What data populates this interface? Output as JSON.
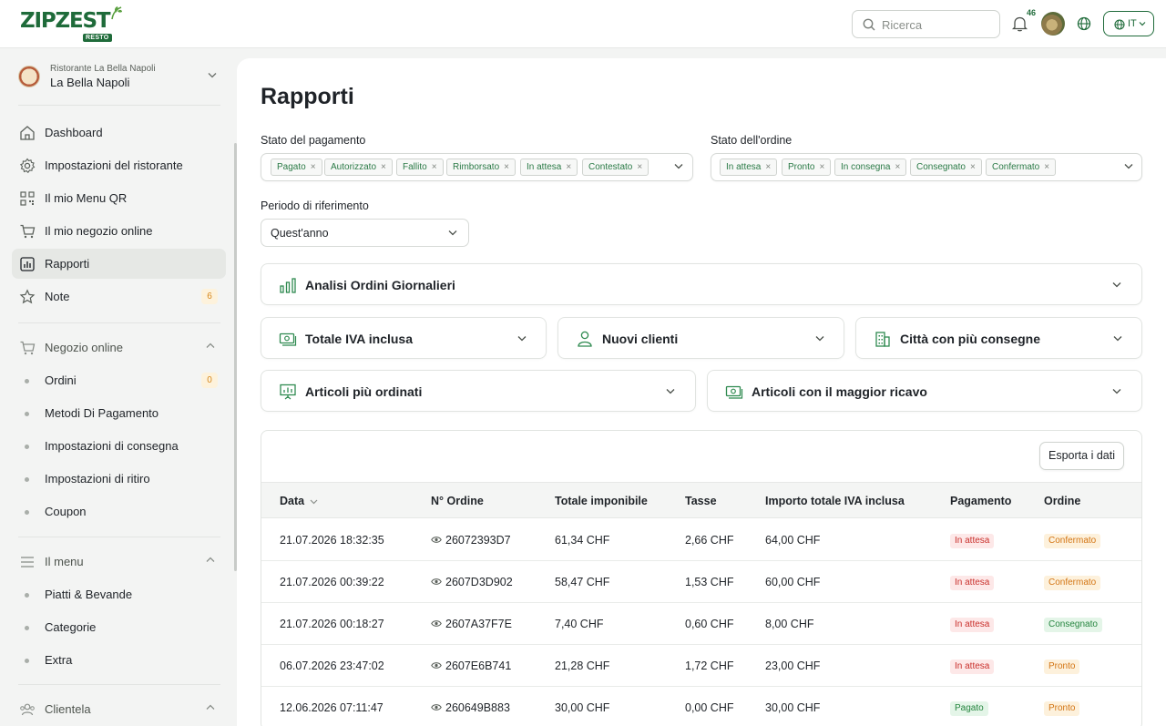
{
  "header": {
    "logo_text": "ZIPZEST",
    "logo_badge": "RESTO",
    "search_placeholder": "Ricerca",
    "notifications_count": "46",
    "language": "IT"
  },
  "sidebar": {
    "restaurant_sub": "Ristorante La Bella Napoli",
    "restaurant_name": "La Bella Napoli",
    "items": {
      "dashboard": "Dashboard",
      "settings": "Impostazioni del ristorante",
      "menu_qr": "Il mio Menu QR",
      "shop": "Il mio negozio online",
      "reports": "Rapporti",
      "notes": "Note",
      "notes_count": "6"
    },
    "online_shop": {
      "title": "Negozio online",
      "orders": "Ordini",
      "orders_count": "0",
      "payment_methods": "Metodi Di Pagamento",
      "delivery_settings": "Impostazioni di consegna",
      "pickup_settings": "Impostazioni di ritiro",
      "coupon": "Coupon"
    },
    "menu": {
      "title": "Il menu",
      "dishes": "Piatti & Bevande",
      "categories": "Categorie",
      "extras": "Extra"
    },
    "clients": {
      "title": "Clientela"
    }
  },
  "page": {
    "title": "Rapporti",
    "payment_filter": {
      "label": "Stato del pagamento",
      "chips": [
        "Pagato",
        "Autorizzato",
        "Fallito",
        "Rimborsato",
        "In attesa",
        "Contestato"
      ]
    },
    "order_filter": {
      "label": "Stato dell'ordine",
      "chips": [
        "In attesa",
        "Pronto",
        "In consegna",
        "Consegnato",
        "Confermato"
      ]
    },
    "period": {
      "label": "Periodo di riferimento",
      "value": "Quest'anno"
    },
    "cards": {
      "daily": "Analisi Ordini Giornalieri",
      "total_vat": "Totale IVA inclusa",
      "new_clients": "Nuovi clienti",
      "cities": "Città con più consegne",
      "top_items": "Articoli più ordinati",
      "top_revenue": "Articoli con il maggior ricavo"
    },
    "export_label": "Esporta i dati",
    "table": {
      "headers": {
        "date": "Data",
        "order_no": "N° Ordine",
        "taxable": "Totale imponibile",
        "tax": "Tasse",
        "total": "Importo totale IVA inclusa",
        "payment": "Pagamento",
        "order": "Ordine"
      },
      "rows": [
        {
          "date": "21.07.2026 18:32:35",
          "id": "26072393D7",
          "taxable": "61,34 CHF",
          "tax": "2,66 CHF",
          "total": "64,00 CHF",
          "payment": "In attesa",
          "order": "Confermato"
        },
        {
          "date": "21.07.2026 00:39:22",
          "id": "2607D3D902",
          "taxable": "58,47 CHF",
          "tax": "1,53 CHF",
          "total": "60,00 CHF",
          "payment": "In attesa",
          "order": "Confermato"
        },
        {
          "date": "21.07.2026 00:18:27",
          "id": "2607A37F7E",
          "taxable": "7,40 CHF",
          "tax": "0,60 CHF",
          "total": "8,00 CHF",
          "payment": "In attesa",
          "order": "Consegnato"
        },
        {
          "date": "06.07.2026 23:47:02",
          "id": "2607E6B741",
          "taxable": "21,28 CHF",
          "tax": "1,72 CHF",
          "total": "23,00 CHF",
          "payment": "In attesa",
          "order": "Pronto"
        },
        {
          "date": "12.06.2026 07:11:47",
          "id": "260649B883",
          "taxable": "30,00 CHF",
          "tax": "0,00 CHF",
          "total": "30,00 CHF",
          "payment": "Pagato",
          "order": "Pronto"
        }
      ]
    }
  },
  "colors": {
    "brand": "#1f6b3a",
    "badge_red": "#c9302c",
    "badge_green": "#25853f",
    "badge_orange": "#d37514"
  }
}
